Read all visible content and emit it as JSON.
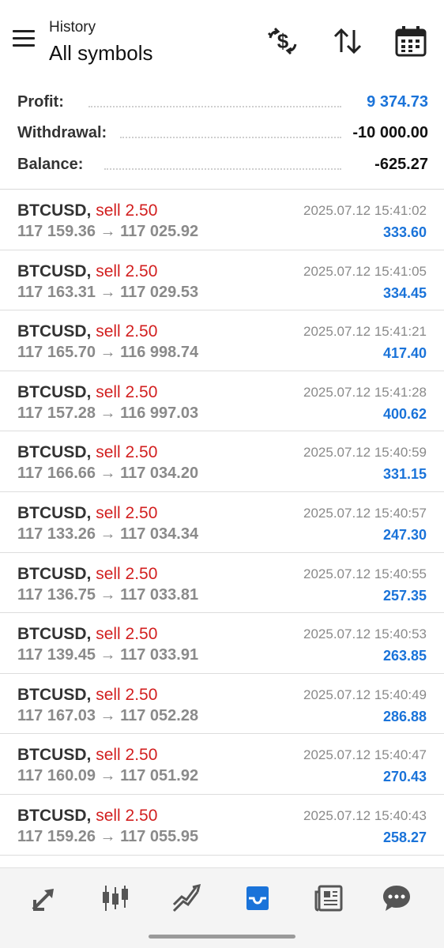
{
  "header": {
    "subtitle": "History",
    "title": "All symbols",
    "icons": [
      "dollar-exchange-icon",
      "sort-icon",
      "calendar-icon"
    ]
  },
  "summary": {
    "profit_label": "Profit:",
    "profit_value": "9 374.73",
    "withdrawal_label": "Withdrawal:",
    "withdrawal_value": "-10 000.00",
    "balance_label": "Balance:",
    "balance_value": "-625.27"
  },
  "trades": [
    {
      "symbol": "BTCUSD,",
      "side": "sell 2.50",
      "prices": "117 159.36 → 117 025.92",
      "time": "2025.07.12 15:41:02",
      "profit": "333.60"
    },
    {
      "symbol": "BTCUSD,",
      "side": "sell 2.50",
      "prices": "117 163.31 → 117 029.53",
      "time": "2025.07.12 15:41:05",
      "profit": "334.45"
    },
    {
      "symbol": "BTCUSD,",
      "side": "sell 2.50",
      "prices": "117 165.70 → 116 998.74",
      "time": "2025.07.12 15:41:21",
      "profit": "417.40"
    },
    {
      "symbol": "BTCUSD,",
      "side": "sell 2.50",
      "prices": "117 157.28 → 116 997.03",
      "time": "2025.07.12 15:41:28",
      "profit": "400.62"
    },
    {
      "symbol": "BTCUSD,",
      "side": "sell 2.50",
      "prices": "117 166.66 → 117 034.20",
      "time": "2025.07.12 15:40:59",
      "profit": "331.15"
    },
    {
      "symbol": "BTCUSD,",
      "side": "sell 2.50",
      "prices": "117 133.26 → 117 034.34",
      "time": "2025.07.12 15:40:57",
      "profit": "247.30"
    },
    {
      "symbol": "BTCUSD,",
      "side": "sell 2.50",
      "prices": "117 136.75 → 117 033.81",
      "time": "2025.07.12 15:40:55",
      "profit": "257.35"
    },
    {
      "symbol": "BTCUSD,",
      "side": "sell 2.50",
      "prices": "117 139.45 → 117 033.91",
      "time": "2025.07.12 15:40:53",
      "profit": "263.85"
    },
    {
      "symbol": "BTCUSD,",
      "side": "sell 2.50",
      "prices": "117 167.03 → 117 052.28",
      "time": "2025.07.12 15:40:49",
      "profit": "286.88"
    },
    {
      "symbol": "BTCUSD,",
      "side": "sell 2.50",
      "prices": "117 160.09 → 117 051.92",
      "time": "2025.07.12 15:40:47",
      "profit": "270.43"
    },
    {
      "symbol": "BTCUSD,",
      "side": "sell 2.50",
      "prices": "117 159.26 → 117 055.95",
      "time": "2025.07.12 15:40:43",
      "profit": "258.27"
    }
  ],
  "bottom_nav": {
    "items": [
      "quotes-icon",
      "chart-icon",
      "trade-icon",
      "history-icon",
      "news-icon",
      "chat-icon"
    ],
    "active": "history-icon"
  },
  "colors": {
    "accent": "#1a73d9",
    "sell": "#d21f1f",
    "muted": "#8a8a8a"
  }
}
